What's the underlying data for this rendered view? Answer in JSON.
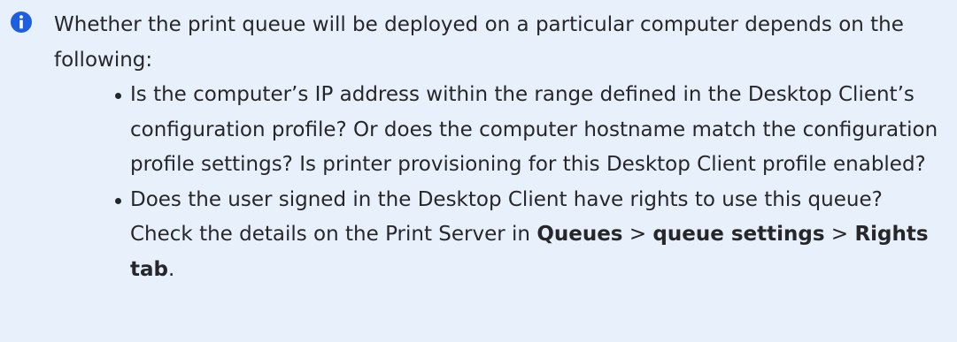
{
  "note": {
    "icon": "info-icon",
    "accent_color": "#1e5fe0",
    "background_color": "#e8f0fb",
    "intro": "Whether the print queue will be deployed on a particular computer depends on the following:",
    "items": [
      {
        "text": "Is the computer’s IP address within the range defined in the Desktop Client’s configuration profile? Or does the computer hostname match the configuration profile settings? Is printer provisioning for this Desktop Client profile enabled?"
      },
      {
        "text_before": "Does the user signed in the Desktop Client have rights to use this queue? Check the details on the Print Server in ",
        "queues": "Queues",
        "sep1": " > ",
        "queue_settings": "queue settings",
        "sep2": " > ",
        "rights_tab": "Rights tab",
        "end": "."
      }
    ]
  }
}
